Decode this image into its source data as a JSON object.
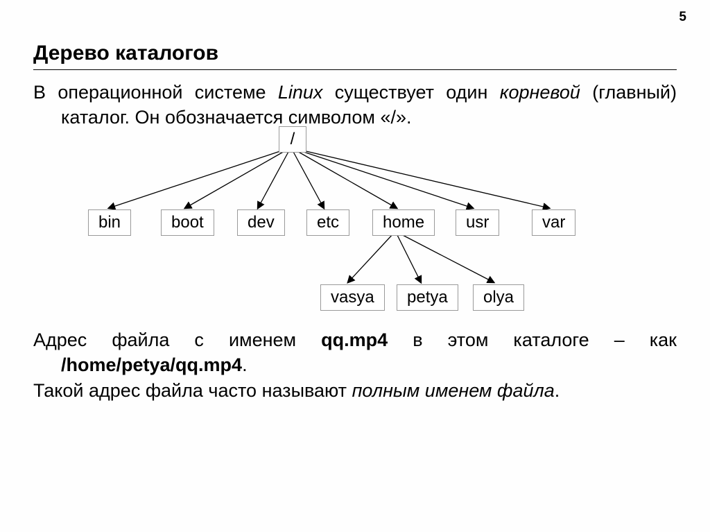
{
  "page_number": "5",
  "title": "Дерево каталогов",
  "intro": {
    "t1": "В операционной системе ",
    "linux": "Linux",
    "t2": " существует один ",
    "root_word": "корневой",
    "t3": " (главный) каталог. Он обозначается символом «/»."
  },
  "tree": {
    "root": "/",
    "level1": [
      "bin",
      "boot",
      "dev",
      "etc",
      "home",
      "usr",
      "var"
    ],
    "level2": [
      "vasya",
      "petya",
      "olya"
    ]
  },
  "mid": {
    "t1": "Адрес файла с именем ",
    "file": "qq.mp4",
    "t2": " в этом каталоге – как ",
    "path": "/home/petya/qq.mp4",
    "t3": "."
  },
  "last": {
    "t1": "Такой адрес файла часто называют ",
    "fullname": "полным именем файла",
    "t2": "."
  }
}
